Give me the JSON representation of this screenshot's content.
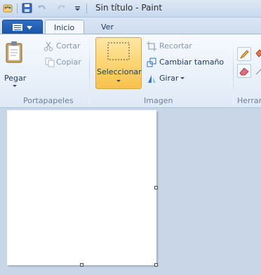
{
  "window": {
    "title": "Sin título - Paint"
  },
  "tabs": [
    {
      "label": "Inicio",
      "active": true
    },
    {
      "label": "Ver",
      "active": false
    }
  ],
  "ribbon": {
    "clipboard": {
      "paste_label": "Pegar",
      "cut_label": "Cortar",
      "copy_label": "Copiar",
      "group_label": "Portapapeles"
    },
    "image": {
      "select_label": "Seleccionar",
      "crop_label": "Recortar",
      "resize_label": "Cambiar tamaño",
      "rotate_label": "Girar",
      "group_label": "Imagen"
    },
    "tools": {
      "group_label": "Herram"
    }
  },
  "colors": {
    "select_highlight": "#fbd36e",
    "ribbon_bg": "#eaf1fa",
    "workspace_bg": "#c9d6e8"
  }
}
